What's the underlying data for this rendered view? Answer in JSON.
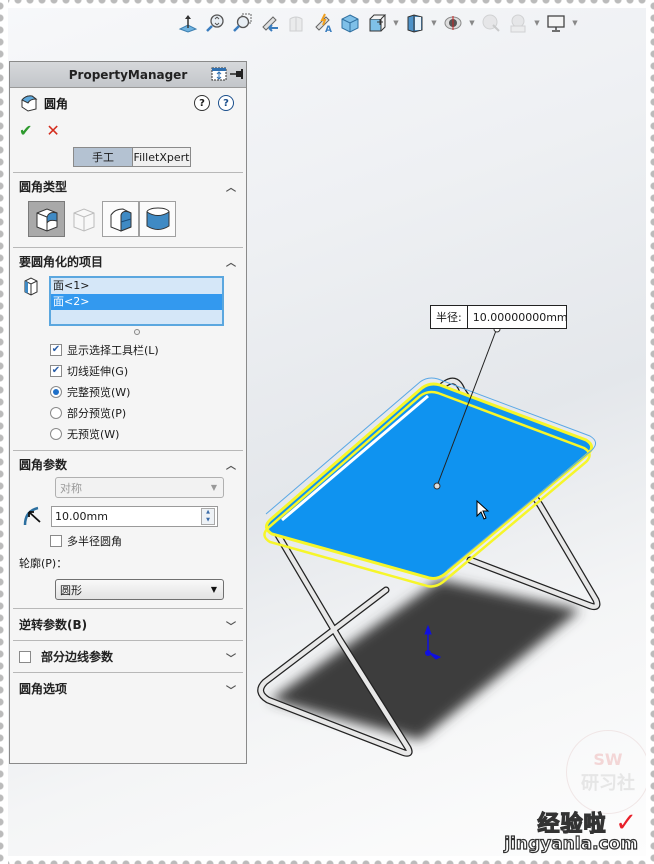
{
  "toolbar": {
    "icons": [
      {
        "name": "view-orientation-normal-to-icon"
      },
      {
        "name": "zoom-to-fit-icon"
      },
      {
        "name": "zoom-to-area-icon"
      },
      {
        "name": "previous-view-icon"
      },
      {
        "name": "section-view-icon"
      },
      {
        "name": "dynamic-annotation-views-icon"
      },
      {
        "name": "view-orientation-icon"
      },
      {
        "name": "display-style-icon",
        "dropdown": true
      },
      {
        "name": "hide-show-items-icon",
        "dropdown": true
      },
      {
        "name": "edit-appearance-icon",
        "dropdown": true
      },
      {
        "name": "apply-scene-icon"
      },
      {
        "name": "view-settings-icon",
        "dropdown": true
      },
      {
        "name": "screen-display-icon",
        "dropdown": true
      }
    ]
  },
  "property_manager": {
    "header_title": "PropertyManager",
    "feature_title": "圆角",
    "ok_symbol": "✔",
    "cancel_symbol": "✕",
    "help_symbol": "?",
    "modes": {
      "manual": "手工",
      "xpert": "FilletXpert",
      "active": "manual"
    },
    "sections": {
      "fillet_type": {
        "title": "圆角类型",
        "types": [
          {
            "name": "constant-size-fillet",
            "active": true
          },
          {
            "name": "variable-size-fillet",
            "active": false
          },
          {
            "name": "face-fillet",
            "active": false
          },
          {
            "name": "full-round-fillet",
            "active": false
          }
        ]
      },
      "items_to_fillet": {
        "title": "要圆角化的项目",
        "list": [
          {
            "label": "面<1>",
            "selected": false
          },
          {
            "label": "面<2>",
            "selected": true
          }
        ],
        "options": {
          "show_selection_toolbar": {
            "label": "显示选择工具栏(L)",
            "checked": true
          },
          "tangent_propagation": {
            "label": "切线延伸(G)",
            "checked": true
          }
        },
        "preview": [
          {
            "label": "完整预览(W)",
            "selected": true
          },
          {
            "label": "部分预览(P)",
            "selected": false
          },
          {
            "label": "无预览(W)",
            "selected": false
          }
        ]
      },
      "fillet_params": {
        "title": "圆角参数",
        "method": "对称",
        "radius": "10.00mm",
        "multi_radius": {
          "label": "多半径圆角",
          "checked": false
        },
        "profile_label": "轮廓(P)：",
        "profile_value": "圆形"
      },
      "setback_params": {
        "title": "逆转参数(B)"
      },
      "partial_edge_params": {
        "title": "部分边线参数",
        "checked": false
      },
      "fillet_options": {
        "title": "圆角选项"
      }
    },
    "chevron_up": "︿",
    "chevron_down": "﹀"
  },
  "viewport": {
    "callout_label": "半径:",
    "callout_value": "10.00000000mm",
    "highlight_color": "#0095f6",
    "edge_highlight_color": "#f6f62a"
  },
  "watermark": {
    "stamp_text": "SW",
    "stamp_cn": "研习社",
    "site_cn": "经验啦",
    "site_check": "✓",
    "site_en": "jingyanla.com"
  }
}
